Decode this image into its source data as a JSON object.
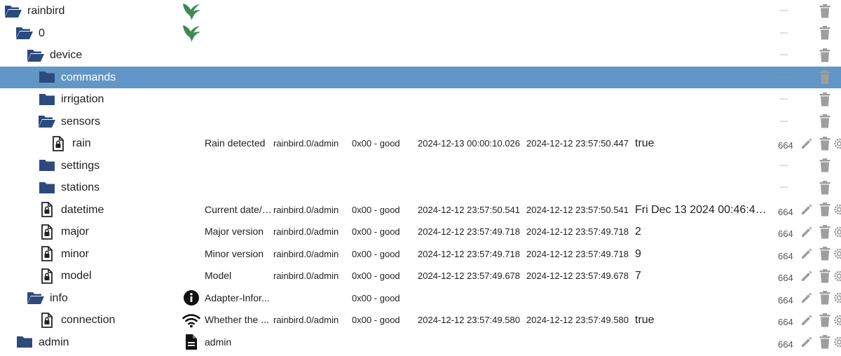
{
  "rows": [
    {
      "name": "rainbird",
      "icon": "folder-open-icon",
      "level": 0,
      "role_icon": "bird-logo-icon",
      "acl": "---",
      "actions": "delete"
    },
    {
      "name": "0",
      "icon": "folder-open-icon",
      "level": 1,
      "role_icon": "bird-logo-icon",
      "acl": "---",
      "actions": "delete"
    },
    {
      "name": "device",
      "icon": "folder-open-icon",
      "level": 2,
      "acl": "---",
      "actions": "delete"
    },
    {
      "name": "commands",
      "icon": "folder-closed-icon",
      "level": 3,
      "selected": true,
      "acl": "---",
      "actions": "delete"
    },
    {
      "name": "irrigation",
      "icon": "folder-closed-icon",
      "level": 3,
      "acl": "---",
      "actions": "delete"
    },
    {
      "name": "sensors",
      "icon": "folder-open-icon",
      "level": 3,
      "acl": "---",
      "actions": "delete"
    },
    {
      "name": "rain",
      "icon": "state-file-icon",
      "level": 4,
      "desc": "Rain detected",
      "from": "rainbird.0/admin",
      "quality": "0x00 - good",
      "ts": "2024-12-13 00:00:10.026",
      "lc": "2024-12-12 23:57:50.447",
      "value": "true",
      "acl": "664",
      "actions": "full"
    },
    {
      "name": "settings",
      "icon": "folder-closed-icon",
      "level": 3,
      "acl": "---",
      "actions": "delete"
    },
    {
      "name": "stations",
      "icon": "folder-closed-icon",
      "level": 3,
      "acl": "---",
      "actions": "delete"
    },
    {
      "name": "datetime",
      "icon": "state-file-icon",
      "level": 3,
      "desc": "Current date/t...",
      "from": "rainbird.0/admin",
      "quality": "0x00 - good",
      "ts": "2024-12-12 23:57:50.541",
      "lc": "2024-12-12 23:57:50.541",
      "value": "Fri Dec 13 2024 00:46:40 ...",
      "acl": "664",
      "actions": "full"
    },
    {
      "name": "major",
      "icon": "state-file-icon",
      "level": 3,
      "desc": "Major version",
      "from": "rainbird.0/admin",
      "quality": "0x00 - good",
      "ts": "2024-12-12 23:57:49.718",
      "lc": "2024-12-12 23:57:49.718",
      "value": "2",
      "acl": "664",
      "actions": "full"
    },
    {
      "name": "minor",
      "icon": "state-file-icon",
      "level": 3,
      "desc": "Minor version",
      "from": "rainbird.0/admin",
      "quality": "0x00 - good",
      "ts": "2024-12-12 23:57:49.718",
      "lc": "2024-12-12 23:57:49.718",
      "value": "9",
      "acl": "664",
      "actions": "full"
    },
    {
      "name": "model",
      "icon": "state-file-icon",
      "level": 3,
      "desc": "Model",
      "from": "rainbird.0/admin",
      "quality": "0x00 - good",
      "ts": "2024-12-12 23:57:49.678",
      "lc": "2024-12-12 23:57:49.678",
      "value": "7",
      "acl": "664",
      "actions": "full"
    },
    {
      "name": "info",
      "icon": "folder-open-icon",
      "level": 2,
      "role_icon": "info-circle-icon",
      "desc": "Adapter-Infor...",
      "quality": "0x00 - good",
      "acl": "664",
      "actions": "full"
    },
    {
      "name": "connection",
      "icon": "state-file-icon",
      "level": 3,
      "role_icon": "wifi-icon",
      "desc": "Whether the ...",
      "from": "rainbird.0/admin",
      "quality": "0x00 - good",
      "ts": "2024-12-12 23:57:49.580",
      "lc": "2024-12-12 23:57:49.580",
      "value": "true",
      "acl": "664",
      "actions": "full"
    },
    {
      "name": "admin",
      "icon": "folder-closed-icon",
      "level": 1,
      "role_icon": "document-icon",
      "desc": "admin",
      "acl": "664",
      "actions": "full"
    }
  ],
  "colors": {
    "folder": "#2c4a7e",
    "selected_row": "#6196c6",
    "action_icon": "#9e9e9e",
    "bird_logo": "#3e8a55"
  }
}
